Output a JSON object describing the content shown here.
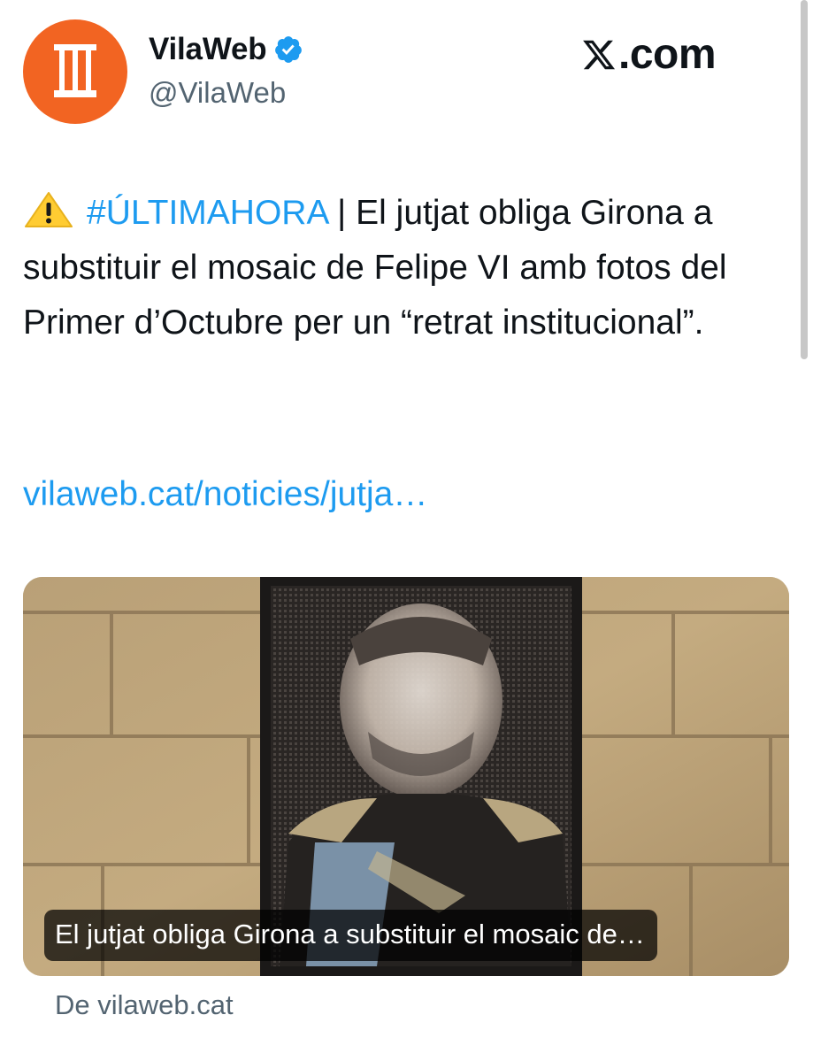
{
  "account": {
    "name": "VilaWeb",
    "handle": "@VilaWeb",
    "avatar_color": "#f26422",
    "verified_icon": "verified-badge-icon"
  },
  "brand": {
    "watermark_text": ".com",
    "logo_icon": "x-logo-icon"
  },
  "tweet": {
    "warning_icon": "warning-emoji-icon",
    "hashtag": "#ÚLTIMAHORA",
    "body": " | El jutjat obliga Girona a substituir el mosaic de Felipe VI amb fotos del Primer d’Octubre per un “retrat institucional”.",
    "link": "vilaweb.cat/noticies/jutja…",
    "link_color": "#1d9bf0"
  },
  "card": {
    "caption": "El jutjat obliga Girona a substituir el mosaic de…",
    "source": "De vilaweb.cat"
  }
}
